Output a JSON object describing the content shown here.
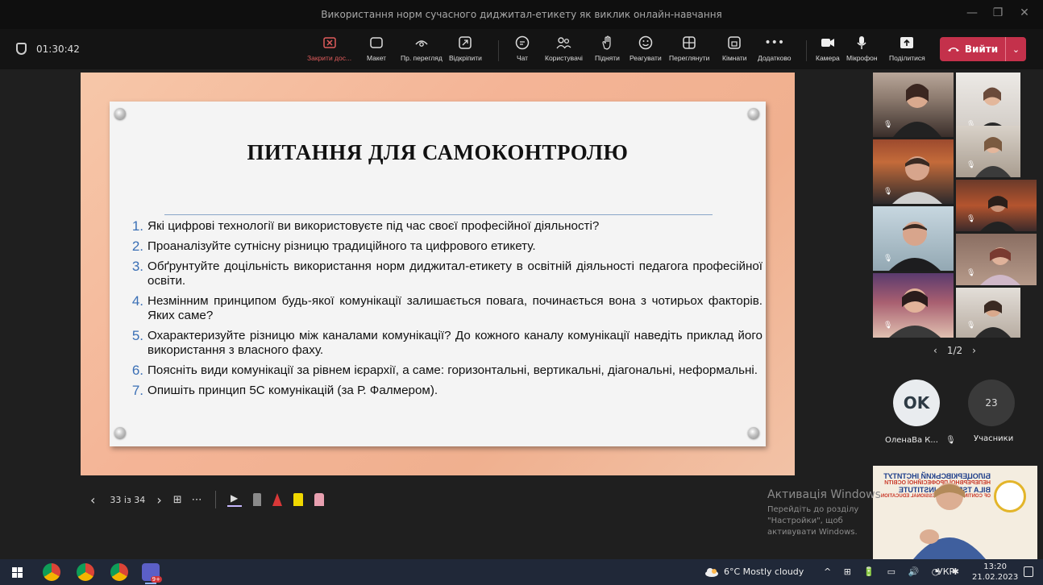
{
  "window": {
    "title": "Використання норм сучасного диджитал-етикету як виклик онлайн-навчання"
  },
  "meeting": {
    "timer": "01:30:42",
    "toolbar": [
      {
        "id": "stop-sharing",
        "label": "Закрити дос..."
      },
      {
        "id": "layout",
        "label": "Макет"
      },
      {
        "id": "presenter-view",
        "label": "Пр. перегляд"
      },
      {
        "id": "pop-out",
        "label": "Відкріпити"
      },
      {
        "id": "chat",
        "label": "Чат"
      },
      {
        "id": "people",
        "label": "Користувачі"
      },
      {
        "id": "raise-hand",
        "label": "Підняти"
      },
      {
        "id": "react",
        "label": "Реагувати"
      },
      {
        "id": "view",
        "label": "Переглянути"
      },
      {
        "id": "rooms",
        "label": "Кімнати"
      },
      {
        "id": "more",
        "label": "Додатково"
      },
      {
        "id": "camera",
        "label": "Камера"
      },
      {
        "id": "mic",
        "label": "Мікрофон"
      },
      {
        "id": "share",
        "label": "Поділитися"
      }
    ],
    "leave_label": "Вийти"
  },
  "slide": {
    "title": "ПИТАННЯ ДЛЯ САМОКОНТРОЛЮ",
    "questions": [
      {
        "n": "1.",
        "text": "Які цифрові технології ви використовуєте під час своєї професійної діяльності?"
      },
      {
        "n": "2.",
        "text": "Проаналізуйте сутнісну різницю традиційного та цифрового етикету."
      },
      {
        "n": "3.",
        "text": "Обґрунтуйте доцільність використання норм диджитал-етикету в освітній діяльності педагога професійної освіти."
      },
      {
        "n": "4.",
        "text": "Незмінним принципом будь-якої комунікації залишається повага, починається вона з чотирьох факторів. Яких саме?"
      },
      {
        "n": "5.",
        "text": "Охарактеризуйте різницю між каналами комунікації? До кожного каналу комунікації наведіть приклад його використання з власного фаху."
      },
      {
        "n": "6.",
        "text": "Поясніть види комунікації за рівнем ієрархії, а саме: горизонтальні, вертикальні, діагональні, неформальні."
      },
      {
        "n": "7.",
        "text": "Опишіть принцип 5С комунікацій (за Р. Фалмером)."
      }
    ],
    "counter": "33 із 34"
  },
  "participants": {
    "pager": "1/2",
    "avatar_initials": "OK",
    "avatar_name": "ОленаВа К...",
    "count": "23",
    "count_label": "Учасники"
  },
  "watermark": {
    "line1": "Активація Windows",
    "line2": "Перейдіть до розділу \"Настройки\", щоб активувати Windows."
  },
  "banner": {
    "line1": "БІЛОЦЕРКІВСЬКИЙ ІНСТИТУТ",
    "line2": "НЕПЕРЕРВНОЇ ПРОФЕСІЙНОЇ ОСВІТИ",
    "line3": "BILA TSERKVA INSTITUTE",
    "line4": "OF CONTINUOUS PROFESSIONAL EDUCATION"
  },
  "taskbar": {
    "weather": "6°C  Mostly cloudy",
    "lang": "УКР",
    "time": "13:20",
    "date": "21.02.2023",
    "badge": "9+"
  },
  "colors": {
    "accent_red": "#c4314b",
    "slide_number_blue": "#3a6fb5",
    "slide_frame": "#f4b496"
  }
}
